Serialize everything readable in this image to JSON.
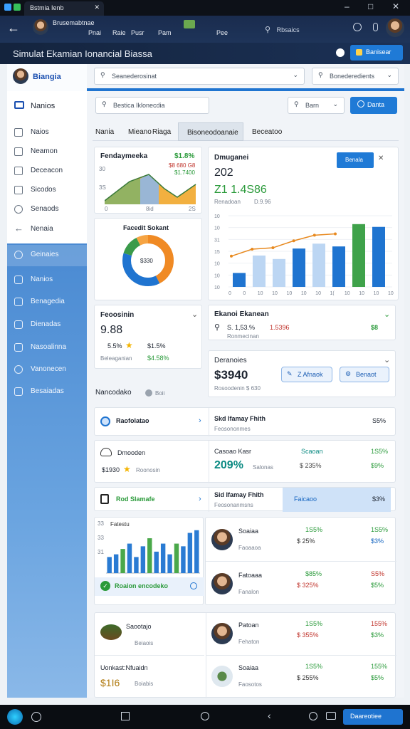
{
  "window": {
    "tab_title": "Bstmia Ienb",
    "minimize": "–",
    "maximize": "□",
    "close": "✕"
  },
  "browser": {
    "items": [
      "Brusemabtnae",
      "Pnai",
      "Raie",
      "Pusr",
      "Pam",
      "Pee"
    ],
    "search_label": "Rbsaics"
  },
  "app": {
    "title": "Simulat Ekamian Ionancial Biassa",
    "admin_button": "Banisear"
  },
  "sidebar": {
    "brand": "Biangia",
    "section": "Nanios",
    "items": [
      "Naios",
      "Neamon",
      "Deceacon",
      "Sicodos",
      "Senaods",
      "Nenaia"
    ],
    "blue_items": [
      "Geinaies",
      "Nanios",
      "Benagedia",
      "Dienadas",
      "Nasoalinna",
      "Vanonecen",
      "Besaiadas"
    ]
  },
  "filters": {
    "select1": "Seanederosinat",
    "select2": "Bonederedients",
    "search": "Bestica Iklonecdia",
    "search_suffix": "Ieo",
    "sort": "Barn",
    "go": "Danta"
  },
  "tabs": [
    "Nania",
    "Mieano",
    "Riaga",
    "Bisoneodoanaie",
    "Beceatoo"
  ],
  "card_area": {
    "title": "Fendaymeeka",
    "value": "$1.8%",
    "sub": "$8 680 G8",
    "sub2": "$1.7400",
    "ticks": [
      "30",
      "3S",
      "0",
      "8id",
      "2S"
    ]
  },
  "card_main": {
    "title": "Dmuganei",
    "value": "202",
    "delta": "Z1 1.4S86",
    "sub": "Renadoan",
    "sub2": "D.9.96",
    "button": "Benala",
    "ticks_y": [
      "10",
      "10",
      "31",
      "15",
      "10",
      "10",
      "10"
    ],
    "ticks_x": [
      "0",
      "0",
      "10",
      "10",
      "10",
      "10",
      "10",
      "1(",
      "10",
      "10",
      "10",
      "10"
    ]
  },
  "card_donut": {
    "title": "Facedit Sokant",
    "center": "$330"
  },
  "card_fees": {
    "title": "Feoosinin",
    "value": "9.88",
    "pct": "5.5%",
    "amount": "$1.5%",
    "label": "Beleaganian",
    "label_value": "$4.58%"
  },
  "card_ekan": {
    "title": "Ekanoi Ekanean",
    "v1": "S. 1,53.%",
    "v2": "1.5396",
    "v3": "$8",
    "desc": "Ronmecinan"
  },
  "card_dem": {
    "title": "Deranoies",
    "value": "$3940",
    "sub": "Rosoodenin $ 630",
    "btn1": "Z Afnaok",
    "btn2": "Benaot"
  },
  "list_header": {
    "title": "Nancodako",
    "tag": "Boii"
  },
  "rows": {
    "r1": {
      "left": "Raofolatao",
      "title": "Skd Ifamay Fhith",
      "sub": "Feosononmes",
      "pct": "S5%"
    },
    "r2": {
      "left_title": "Dmooden",
      "left_value": "$1930",
      "left_sub": "Roonosin",
      "title": "Casoao Kasr",
      "value": "209%",
      "value_sub": "Salonas",
      "m1": "Scaoan",
      "m2": "$ 235%",
      "r1": "1S5%",
      "r2": "$9%"
    },
    "r3": {
      "left": "Rod Slamafe",
      "title": "Sid Ifamay Fhith",
      "sub": "Feosonanmsns",
      "badge": "Faicaoo",
      "pct": "$3%"
    }
  },
  "chart_data": {
    "type": "bar",
    "title": "Fatestu",
    "ticks_y": [
      "33",
      "33",
      "31"
    ],
    "values": [
      3,
      3.5,
      4.5,
      5.5,
      3,
      5,
      6.5,
      4,
      5.5,
      3.5,
      5.5,
      5,
      7.5,
      8
    ],
    "colors": [
      "#2a7bd3",
      "#2a7bd3",
      "#4aa84a",
      "#2a7bd3",
      "#2a7bd3",
      "#2a7bd3",
      "#4aa84a",
      "#2a7bd3",
      "#2a7bd3",
      "#2a7bd3",
      "#4aa84a",
      "#2a7bd3",
      "#2a7bd3",
      "#2a7bd3"
    ],
    "footer": "Roaion encodeko"
  },
  "people": [
    {
      "name": "Soaiaa",
      "sub": "Faoaaoa",
      "m1": "1S5%",
      "m2": "$ 25%",
      "r1": "1S5%",
      "r2": "$3%"
    },
    {
      "name": "Fatoaaa",
      "sub": "Fanalon",
      "m1": "$85%",
      "m2": "$ 325%",
      "r1": "S5%",
      "r2": "$5%"
    },
    {
      "name": "Patoan",
      "sub": "Fehaton",
      "m1": "1S5%",
      "m2": "$ 355%",
      "r1": "155%",
      "r2": "$3%"
    },
    {
      "name": "Soaiaa",
      "sub": "Faosotos",
      "m1": "1S5%",
      "m2": "$ 255%",
      "r1": "155%",
      "r2": "$5%"
    }
  ],
  "bottom_left": [
    {
      "title": "Saootajo",
      "sub": "Beiaois"
    },
    {
      "title": "Uonkast:Nfuaidn",
      "value": "$1I6",
      "sub": "Boiabis"
    }
  ],
  "taskbar": {
    "button": "Daareotiee"
  }
}
